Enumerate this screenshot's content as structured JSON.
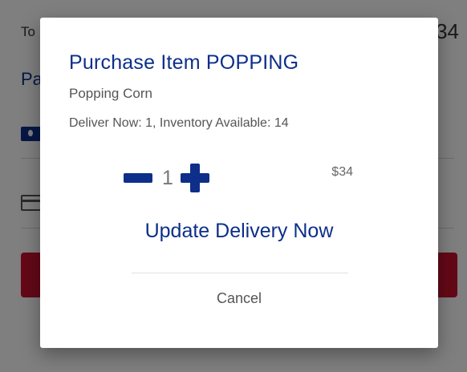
{
  "background": {
    "total_label": "To",
    "total_value": "34",
    "section_label": "Pa"
  },
  "dialog": {
    "title": "Purchase Item POPPING",
    "subtitle": "Popping Corn",
    "info": "Deliver Now:  1, Inventory Available: 14",
    "quantity": "1",
    "price": "$34",
    "update_label": "Update Delivery Now",
    "cancel_label": "Cancel"
  },
  "colors": {
    "accent": "#0d2f8a",
    "danger": "#c8102e"
  },
  "icons": {
    "decrement": "minus-icon",
    "increment": "plus-icon"
  }
}
